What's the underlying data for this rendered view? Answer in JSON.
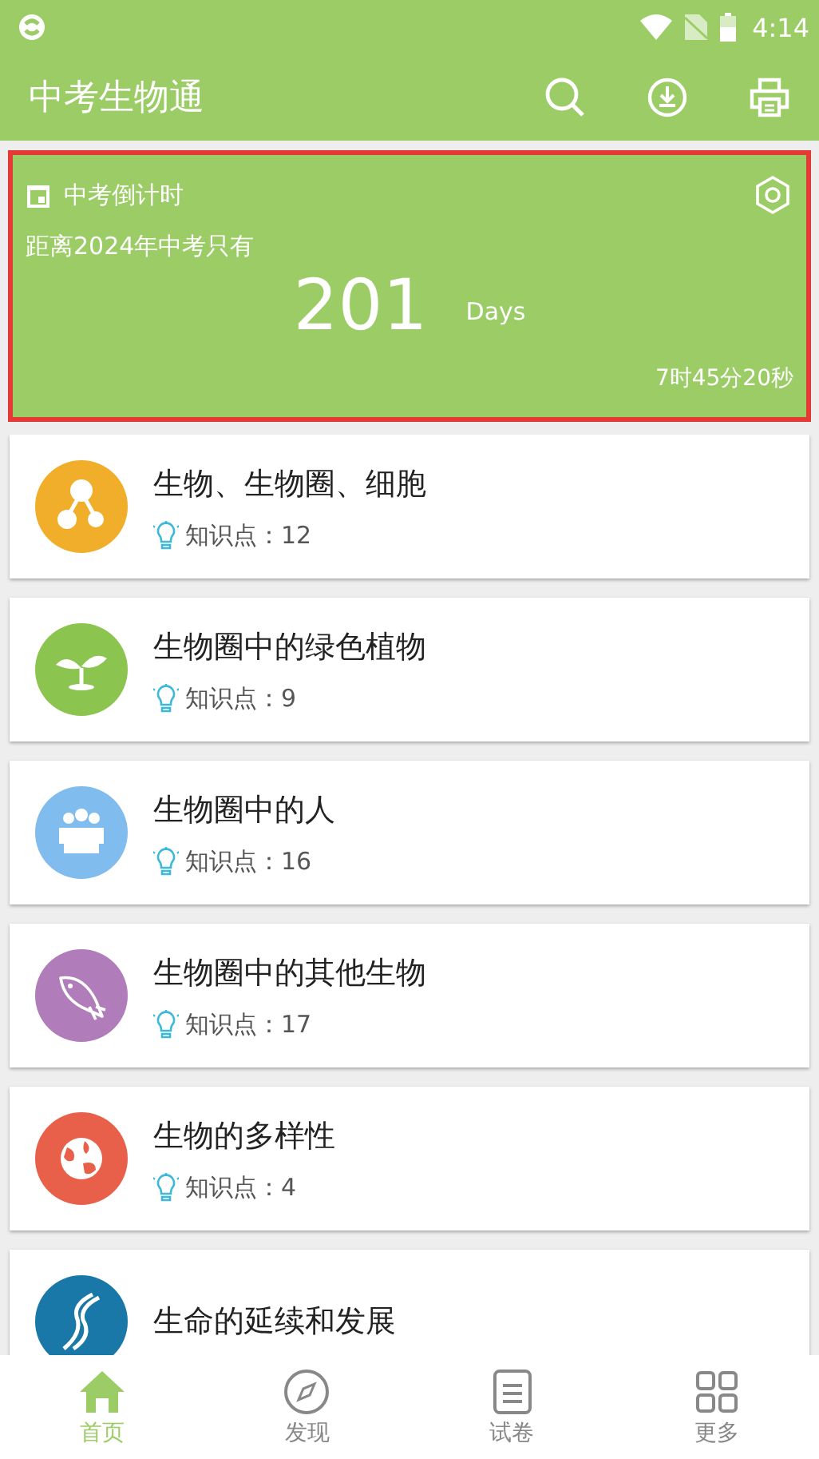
{
  "status_bar": {
    "time": "4:14"
  },
  "app_bar": {
    "title": "中考生物通"
  },
  "countdown": {
    "title": "中考倒计时",
    "subtitle": "距离2024年中考只有",
    "days": "201",
    "unit": "Days",
    "remaining": "7时45分20秒"
  },
  "chapters": [
    {
      "title": "生物、生物圈、细胞",
      "label": "知识点：",
      "count": "12",
      "kind": "molecule",
      "color": "#f0ae2a"
    },
    {
      "title": "生物圈中的绿色植物",
      "label": "知识点：",
      "count": "9",
      "kind": "sprout",
      "color": "#8cc450"
    },
    {
      "title": "生物圈中的人",
      "label": "知识点：",
      "count": "16",
      "kind": "people",
      "color": "#80bcee"
    },
    {
      "title": "生物圈中的其他生物",
      "label": "知识点：",
      "count": "17",
      "kind": "fish",
      "color": "#b07cba"
    },
    {
      "title": "生物的多样性",
      "label": "知识点：",
      "count": "4",
      "kind": "globe",
      "color": "#e8604a"
    },
    {
      "title": "生命的延续和发展",
      "kind": "dna",
      "color": "#1a78a8"
    }
  ],
  "bottom_nav": [
    {
      "label": "首页",
      "kind": "home",
      "selected": true
    },
    {
      "label": "发现",
      "kind": "compass",
      "selected": false
    },
    {
      "label": "试卷",
      "kind": "paper",
      "selected": false
    },
    {
      "label": "更多",
      "kind": "grid",
      "selected": false
    }
  ]
}
